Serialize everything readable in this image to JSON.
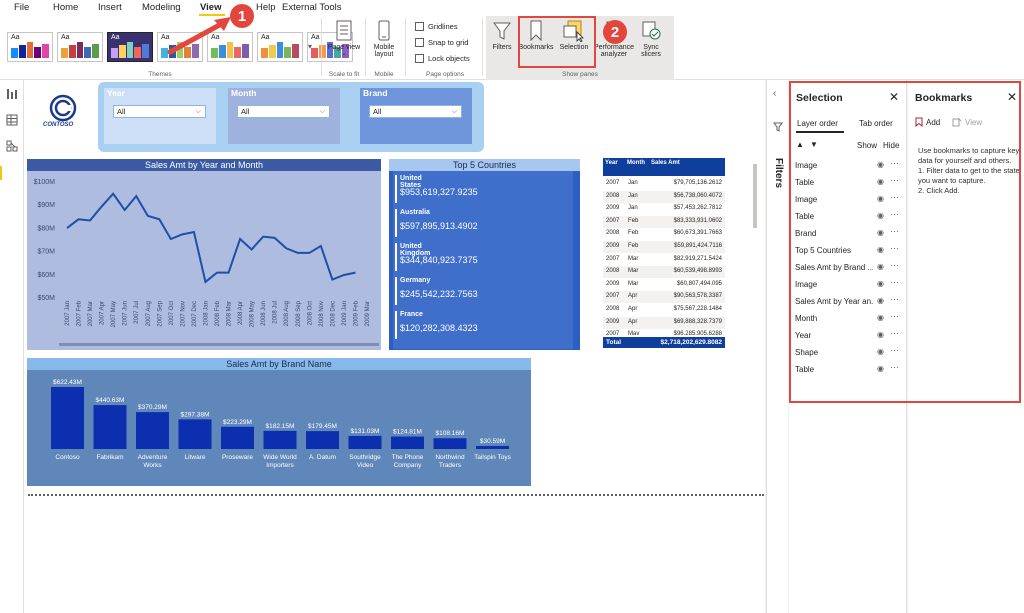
{
  "menu": {
    "tabs": [
      "File",
      "Home",
      "Insert",
      "Modeling",
      "View",
      "Help",
      "External Tools"
    ]
  },
  "ribbon": {
    "themes_label": "Themes",
    "theme_aa": "Aa",
    "page_view": "Page view",
    "page_view_chev": "⌄",
    "scale_to_fit": "Scale to fit",
    "mobile_layout_l1": "Mobile",
    "mobile_layout_l2": "layout",
    "mobile_label": "Mobile",
    "gridlines": "Gridlines",
    "snap_to_grid": "Snap to grid",
    "lock_objects": "Lock objects",
    "page_options": "Page options",
    "filters": "Filters",
    "bookmarks": "Bookmarks",
    "selection": "Selection",
    "performance_l1": "Performance",
    "performance_l2": "analyzer",
    "sync_l1": "Sync",
    "sync_l2": "slicers",
    "show_panes": "Show panes"
  },
  "callouts": {
    "one": "1",
    "two": "2"
  },
  "logo": {
    "text": "CONTOSO"
  },
  "slicers": [
    {
      "title": "Year",
      "value": "All",
      "header_color": "#1d6cb8"
    },
    {
      "title": "Month",
      "value": "All",
      "header_color": "#1f3f8f"
    },
    {
      "title": "Brand",
      "value": "All",
      "header_color": "#1b2a4d"
    }
  ],
  "line_chart": {
    "title": "Sales Amt by Year and Month",
    "y_ticks": [
      "$100M",
      "$90M",
      "$80M",
      "$70M",
      "$60M",
      "$50M"
    ]
  },
  "chart_data": [
    {
      "type": "line",
      "title": "Sales Amt by Year and Month",
      "ylim": [
        50,
        100
      ],
      "y_unit": "$M",
      "x": [
        "2007 Jan",
        "2007 Feb",
        "2007 Mar",
        "2007 Apr",
        "2007 May",
        "2007 Jun",
        "2007 Jul",
        "2007 Aug",
        "2007 Sep",
        "2007 Oct",
        "2007 Nov",
        "2007 Dec",
        "2008 Jan",
        "2008 Feb",
        "2008 Mar",
        "2008 Apr",
        "2008 May",
        "2008 Jun",
        "2008 Jul",
        "2008 Aug",
        "2008 Sep",
        "2008 Oct",
        "2008 Nov",
        "2008 Dec",
        "2009 Jan",
        "2009 Feb",
        "2009 Mar"
      ],
      "values": [
        79.7,
        83.5,
        83.0,
        89.0,
        94.5,
        87.5,
        93.5,
        85.0,
        83.5,
        75.0,
        77.0,
        78.0,
        56.5,
        60.5,
        60.5,
        75.0,
        70.5,
        76.0,
        75.5,
        71.0,
        69.0,
        69.0,
        72.0,
        57.5,
        59.5,
        60.5
      ]
    },
    {
      "type": "bar",
      "title": "Top 5 Countries",
      "categories": [
        "United States",
        "Australia",
        "United Kingdom",
        "Germany",
        "France"
      ],
      "labels": [
        "$953,619,327.9235",
        "$597,895,913.4902",
        "$344,840,923.7375",
        "$245,542,232.7563",
        "$120,282,308.4323"
      ]
    },
    {
      "type": "bar",
      "title": "Sales Amt by Brand Name",
      "categories": [
        "Contoso",
        "Fabrikam",
        "Adventure Works",
        "Litware",
        "Proseware",
        "Wide World Importers",
        "A. Datum",
        "Southridge Video",
        "The Phone Company",
        "Northwind Traders",
        "Tailspin Toys"
      ],
      "values": [
        622.43,
        440.63,
        370.29,
        297.38,
        223.29,
        182.15,
        179.45,
        131.03,
        124.81,
        108.16,
        30.59
      ],
      "labels": [
        "$622.43M",
        "$440.63M",
        "$370.29M",
        "$297.38M",
        "$223.29M",
        "$182.15M",
        "$179.45M",
        "$131.03M",
        "$124.81M",
        "$108.16M",
        "$30.59M"
      ],
      "ylim": [
        0,
        622.43
      ]
    },
    {
      "type": "table",
      "columns": [
        "Year",
        "Month",
        "Sales Amt"
      ],
      "rows": [
        [
          "2007",
          "Jan",
          "$79,705,136.2612"
        ],
        [
          "2008",
          "Jan",
          "$56,738,060.4072"
        ],
        [
          "2009",
          "Jan",
          "$57,453,262.7812"
        ],
        [
          "2007",
          "Feb",
          "$83,333,931.0602"
        ],
        [
          "2008",
          "Feb",
          "$60,673,391.7663"
        ],
        [
          "2009",
          "Feb",
          "$59,891,424.7116"
        ],
        [
          "2007",
          "Mar",
          "$82,919,271.5424"
        ],
        [
          "2008",
          "Mar",
          "$60,539,498.8993"
        ],
        [
          "2009",
          "Mar",
          "$60,807,494.095"
        ],
        [
          "2007",
          "Apr",
          "$90,563,578.3387"
        ],
        [
          "2008",
          "Apr",
          "$75,567,228.1484"
        ],
        [
          "2009",
          "Apr",
          "$69,888,328.7379"
        ],
        [
          "2007",
          "May",
          "$96,285,905.6288"
        ]
      ],
      "total_label": "Total",
      "total_value": "$2,718,202,629.8082"
    }
  ],
  "filters_strip": {
    "label": "Filters"
  },
  "selection_pane": {
    "title": "Selection",
    "tab_layer": "Layer order",
    "tab_tab": "Tab order",
    "show": "Show",
    "hide": "Hide",
    "items": [
      "Image",
      "Table",
      "Image",
      "Table",
      "Brand",
      "Top 5 Countries",
      "Sales Amt by Brand ...",
      "Image",
      "Sales Amt by Year an...",
      "Month",
      "Year",
      "Shape",
      "Table"
    ]
  },
  "bookmarks_pane": {
    "title": "Bookmarks",
    "add": "Add",
    "view": "View",
    "help_text": "Use bookmarks to capture key data for yourself and others.",
    "step1": "1. Filter data to get to the state you want to capture.",
    "step2": "2. Click Add."
  },
  "colors": {
    "callout_red": "#e2463d",
    "accent_yellow": "#f2c811",
    "line_chart_bg": "#aebcdf",
    "line_color": "#1f4fa8",
    "countries_bg": "#2b5fc1",
    "brand_bg": "#5f87b9",
    "brand_bar": "#0c2fb0"
  }
}
